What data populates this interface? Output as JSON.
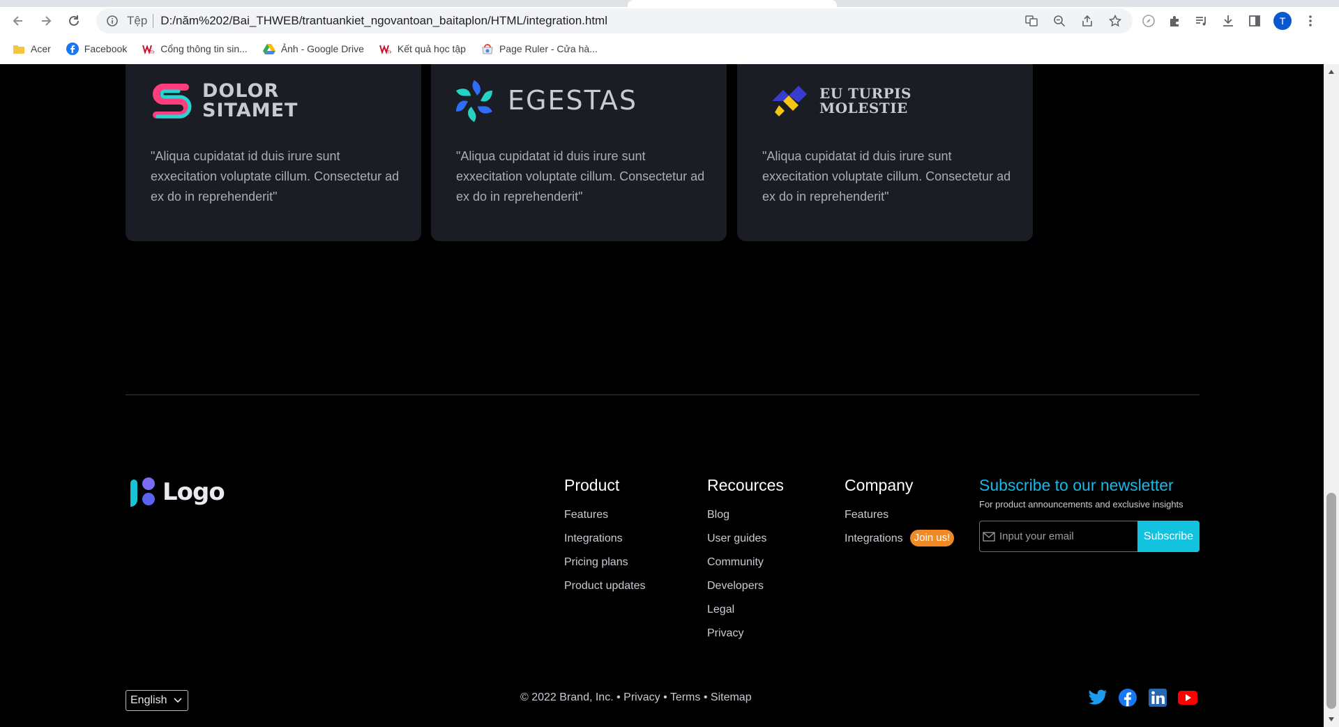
{
  "browser": {
    "url_scheme": "Tệp",
    "url": "D:/năm%202/Bai_THWEB/trantuankiet_ngovantoan_baitaplon/HTML/integration.html",
    "avatar_letter": "T",
    "bookmarks": [
      {
        "label": "Acer",
        "icon": "folder-icon"
      },
      {
        "label": "Facebook",
        "icon": "facebook-icon"
      },
      {
        "label": "Cổng thông tin sin...",
        "icon": "university-icon"
      },
      {
        "label": "Ảnh - Google Drive",
        "icon": "google-drive-icon"
      },
      {
        "label": "Kết quả học tập",
        "icon": "university-icon"
      },
      {
        "label": "Page Ruler - Cửa hà...",
        "icon": "webstore-icon"
      }
    ]
  },
  "cards": [
    {
      "logo_line1": "DOLOR",
      "logo_line2": "SITAMET",
      "quote": "\"Aliqua cupidatat id duis irure sunt exxecitation voluptate cillum. Consectetur ad ex do in reprehenderit\""
    },
    {
      "logo_line1": "EGESTAS",
      "logo_line2": "",
      "quote": "\"Aliqua cupidatat id duis irure sunt exxecitation voluptate cillum. Consectetur ad ex do in reprehenderit\""
    },
    {
      "logo_line1": "EU TURPIS",
      "logo_line2": "MOLESTIE",
      "quote": "\"Aliqua cupidatat id duis irure sunt exxecitation voluptate cillum. Consectetur ad ex do in reprehenderit\""
    }
  ],
  "footer": {
    "logo_text": "Logo",
    "product": {
      "title": "Product",
      "items": [
        "Features",
        "Integrations",
        "Pricing plans",
        "Product updates"
      ]
    },
    "resources": {
      "title": "Recources",
      "items": [
        "Blog",
        "User guides",
        "Community",
        "Developers",
        "Legal",
        "Privacy"
      ]
    },
    "company": {
      "title": "Company",
      "items": [
        "Features",
        "Integrations"
      ],
      "badge": "Join us!"
    },
    "newsletter": {
      "title": "Subscribe to our newsletter",
      "subtitle": "For product announcements and exclusive insights",
      "email_placeholder": "Input your email",
      "button": "Subscribe"
    },
    "language": "English",
    "copyright": "© 2022 Brand, Inc.",
    "links": [
      "Privacy",
      "Terms",
      "Sitemap"
    ],
    "social": [
      "twitter-icon",
      "facebook-icon",
      "linkedin-icon",
      "youtube-icon"
    ]
  },
  "colors": {
    "accent": "#12c2de",
    "badge": "#f08a24",
    "card_bg": "#1a1d24",
    "page_bg": "#000000"
  }
}
